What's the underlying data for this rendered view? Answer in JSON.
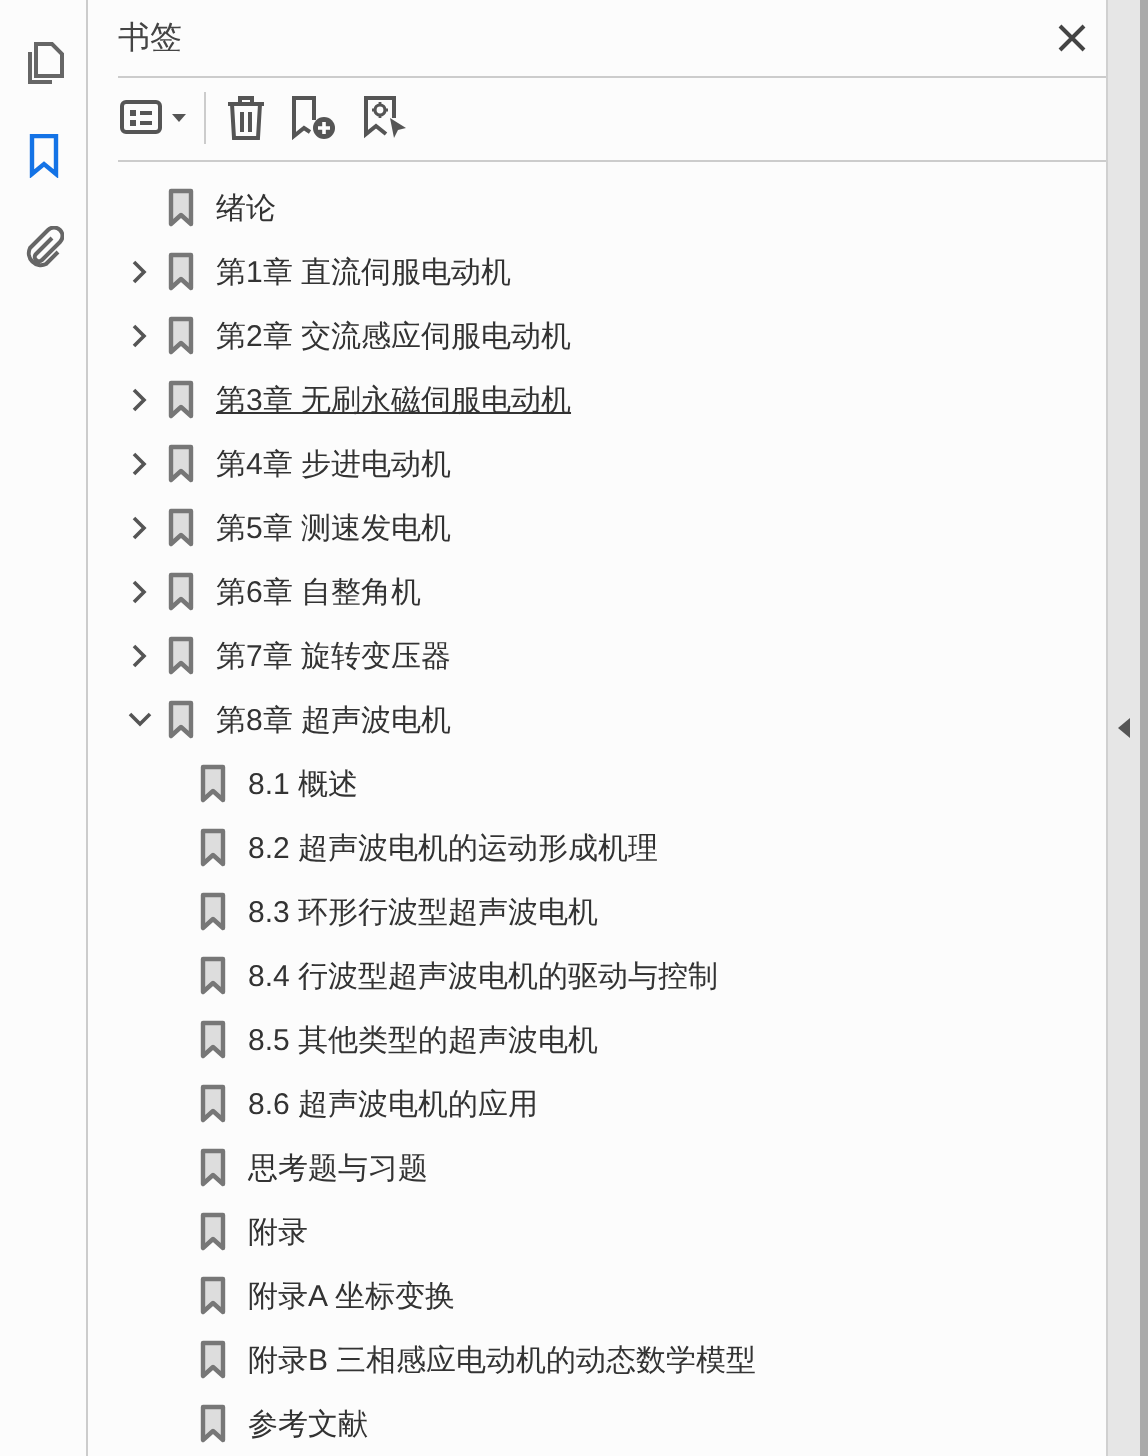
{
  "rail": [
    {
      "selected": false
    },
    {
      "selected": true
    },
    {
      "selected": false
    }
  ],
  "panel": {
    "title": "书签"
  },
  "bookmarks": [
    {
      "label": "绪论"
    },
    {
      "label": "第1章  直流伺服电动机",
      "expanded": false,
      "hovered": false
    },
    {
      "label": "第2章  交流感应伺服电动机",
      "expanded": false,
      "hovered": false
    },
    {
      "label": "第3章  无刷永磁伺服电动机",
      "expanded": false,
      "hovered": true
    },
    {
      "label": "第4章  步进电动机",
      "expanded": false,
      "hovered": false
    },
    {
      "label": "第5章  测速发电机",
      "expanded": false,
      "hovered": false
    },
    {
      "label": "第6章  自整角机",
      "expanded": false,
      "hovered": false
    },
    {
      "label": "第7章  旋转变压器",
      "expanded": false,
      "hovered": false
    },
    {
      "label": "第8章  超声波电机",
      "expanded": true,
      "hovered": false,
      "children": [
        {
          "label": "8.1  概述"
        },
        {
          "label": "8.2  超声波电机的运动形成机理"
        },
        {
          "label": "8.3  环形行波型超声波电机"
        },
        {
          "label": "8.4  行波型超声波电机的驱动与控制"
        },
        {
          "label": "8.5  其他类型的超声波电机"
        },
        {
          "label": "8.6  超声波电机的应用"
        },
        {
          "label": "思考题与习题"
        },
        {
          "label": "附录"
        },
        {
          "label": "附录A  坐标变换"
        },
        {
          "label": "附录B  三相感应电动机的动态数学模型"
        },
        {
          "label": "参考文献"
        }
      ]
    }
  ]
}
